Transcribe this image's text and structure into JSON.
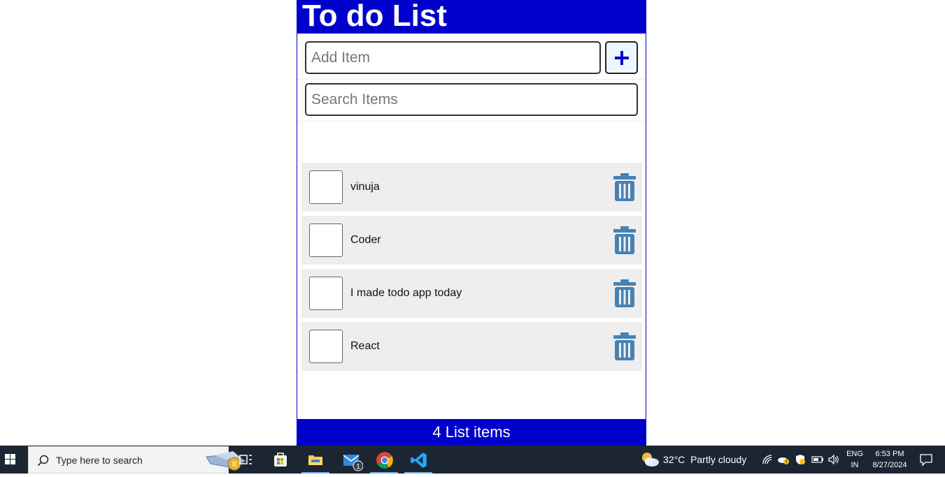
{
  "app": {
    "title": "To do List",
    "add_placeholder": "Add Item",
    "add_button_symbol": "+",
    "search_placeholder": "Search Items",
    "items": [
      {
        "label": "vinuja",
        "checked": false
      },
      {
        "label": "Coder",
        "checked": false
      },
      {
        "label": "I made todo app today",
        "checked": false
      },
      {
        "label": "React",
        "checked": false
      }
    ],
    "footer": "4 List items",
    "colors": {
      "primary": "#0000cc",
      "item_bg": "#eeeeee",
      "trash": "#4682b4"
    }
  },
  "taskbar": {
    "search_placeholder": "Type here to search",
    "mail_badge": "1",
    "weather": {
      "temp": "32°C",
      "condition": "Partly cloudy"
    },
    "language": {
      "line1": "ENG",
      "line2": "IN"
    },
    "clock": {
      "time": "6:53 PM",
      "date": "8/27/2024"
    },
    "pinned_apps": [
      "task-view-icon",
      "store-icon",
      "file-explorer-icon",
      "mail-icon",
      "chrome-icon",
      "vscode-icon"
    ],
    "tray_icons": [
      "network-icon",
      "onedrive-icon",
      "security-icon",
      "battery-icon",
      "volume-icon"
    ]
  }
}
